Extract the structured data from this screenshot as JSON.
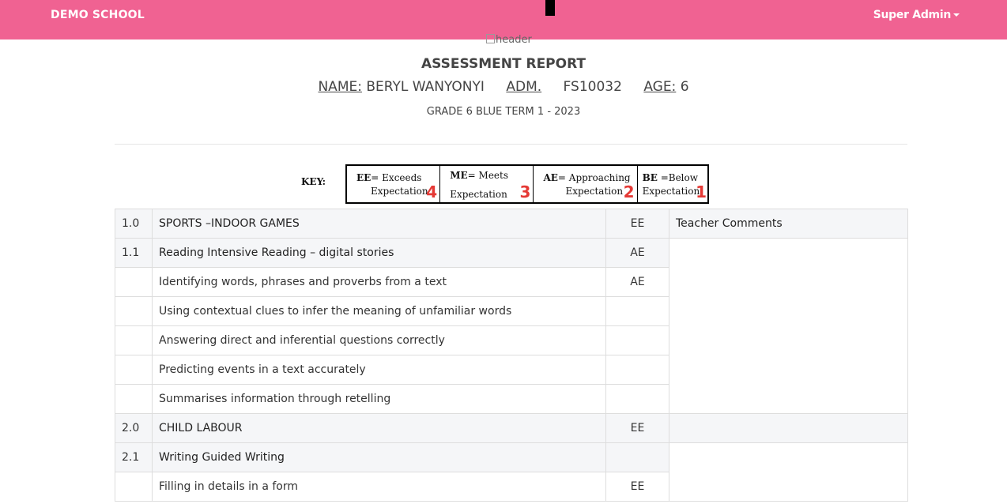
{
  "navbar": {
    "brand": "DEMO SCHOOL",
    "user_label": "Super Admin",
    "background": "#f06292"
  },
  "header_image_alt": "header",
  "report": {
    "title": "ASSESSMENT REPORT",
    "name_label": "NAME:",
    "name_value": "BERYL WANYONYI",
    "adm_label": "ADM.",
    "adm_value": "FS10032",
    "age_label": "AGE:",
    "age_value": "6",
    "grade_term": "GRADE 6 BLUE TERM 1 - 2023"
  },
  "key": {
    "label": "KEY:",
    "items": [
      {
        "code": "EE",
        "line1_rest": "= Exceeds",
        "line2": "Expectation",
        "number": "4"
      },
      {
        "code": "ME",
        "line1_rest": "= Meets",
        "line2": "Expectation",
        "number": "3"
      },
      {
        "code": "AE",
        "line1_rest": "= Approaching",
        "line2": "Expectation",
        "number": "2"
      },
      {
        "code": "BE",
        "line1_rest": " =Below",
        "line2": "Expectation",
        "number": "1"
      }
    ]
  },
  "table": {
    "comments_header": "Teacher Comments",
    "rows": [
      {
        "no": "1.0",
        "desc": "SPORTS –INDOOR GAMES",
        "grade": "EE"
      },
      {
        "no": "1.1",
        "desc": "Reading Intensive Reading – digital stories",
        "grade": "AE"
      },
      {
        "no": "",
        "desc": "Identifying words, phrases and proverbs from a text",
        "grade": "AE"
      },
      {
        "no": "",
        "desc": "Using contextual clues to infer the meaning of unfamiliar words",
        "grade": ""
      },
      {
        "no": "",
        "desc": "Answering direct and inferential questions correctly",
        "grade": ""
      },
      {
        "no": "",
        "desc": "Predicting events in a text accurately",
        "grade": ""
      },
      {
        "no": "",
        "desc": "Summarises information through retelling",
        "grade": ""
      },
      {
        "no": "2.0",
        "desc": "CHILD LABOUR",
        "grade": "EE"
      },
      {
        "no": "2.1",
        "desc": "Writing Guided Writing",
        "grade": ""
      },
      {
        "no": "",
        "desc": "Filling in details in a form",
        "grade": "EE"
      }
    ]
  }
}
